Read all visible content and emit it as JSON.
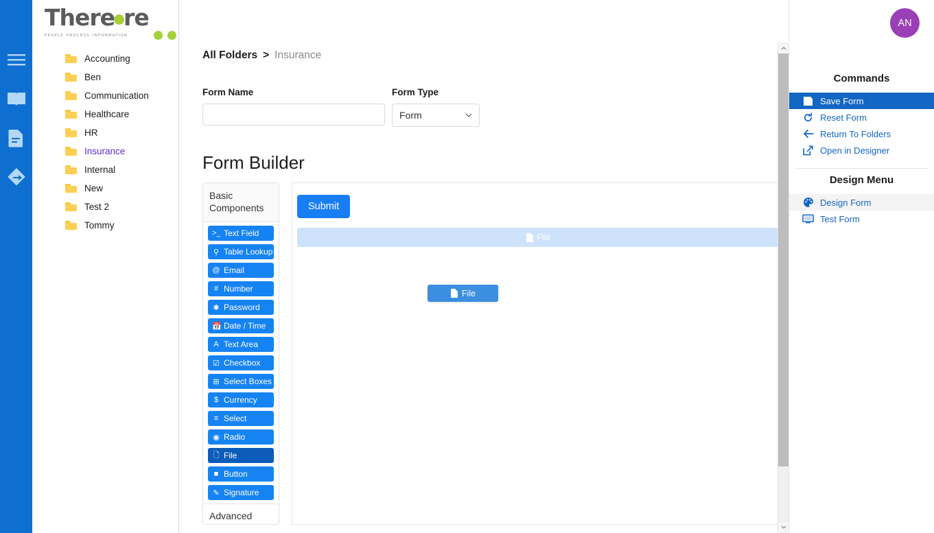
{
  "rail": {
    "icons": [
      {
        "name": "hamburger-menu-icon",
        "label": "Menu"
      },
      {
        "name": "book-icon",
        "label": "Library"
      },
      {
        "name": "document-icon",
        "label": "Documents"
      },
      {
        "name": "workflow-icon",
        "label": "Workflow"
      }
    ]
  },
  "brand": {
    "name_part1": "There",
    "name_part2": "re",
    "tagline_words": [
      "PEOPLE",
      "PROCESS",
      "INFORMATION"
    ],
    "accent_color": "#a7cf38",
    "text_color": "#5b5b5b"
  },
  "tree": {
    "items": [
      {
        "label": "Accounting",
        "expandable": false,
        "selected": false
      },
      {
        "label": "Ben",
        "expandable": false,
        "selected": false
      },
      {
        "label": "Communication",
        "expandable": true,
        "selected": false
      },
      {
        "label": "Healthcare",
        "expandable": false,
        "selected": false
      },
      {
        "label": "HR",
        "expandable": true,
        "selected": false
      },
      {
        "label": "Insurance",
        "expandable": false,
        "selected": true
      },
      {
        "label": "Internal",
        "expandable": true,
        "selected": false
      },
      {
        "label": "New",
        "expandable": false,
        "selected": false
      },
      {
        "label": "Test 2",
        "expandable": false,
        "selected": false
      },
      {
        "label": "Tommy",
        "expandable": false,
        "selected": false
      }
    ],
    "selected_color": "#5b2ecc"
  },
  "header": {
    "avatar_initials": "AN",
    "avatar_color": "#9a3fb5"
  },
  "breadcrumb": {
    "root": "All Folders",
    "separator": ">",
    "current": "Insurance"
  },
  "form_meta": {
    "form_name_label": "Form Name",
    "form_name_value": "",
    "form_name_placeholder": "",
    "form_type_label": "Form Type",
    "form_type_value": "Form",
    "form_type_options": [
      "Form"
    ]
  },
  "builder": {
    "title": "Form Builder",
    "palette": {
      "heading": "Basic Components",
      "components": [
        {
          "label": "Text Field",
          "icon": "terminal-icon",
          "glyph": ">_",
          "active": false
        },
        {
          "label": "Table Lookup",
          "icon": "lookup-icon",
          "glyph": "⚲",
          "active": false
        },
        {
          "label": "Email",
          "icon": "at-icon",
          "glyph": "@",
          "active": false
        },
        {
          "label": "Number",
          "icon": "hash-icon",
          "glyph": "#",
          "active": false
        },
        {
          "label": "Password",
          "icon": "asterisk-icon",
          "glyph": "✱",
          "active": false
        },
        {
          "label": "Date / Time",
          "icon": "calendar-icon",
          "glyph": "Ὄ5",
          "active": false
        },
        {
          "label": "Text Area",
          "icon": "text-size-icon",
          "glyph": "A",
          "active": false
        },
        {
          "label": "Checkbox",
          "icon": "checkbox-icon",
          "glyph": "☑",
          "active": false
        },
        {
          "label": "Select Boxes",
          "icon": "plus-square-icon",
          "glyph": "⊞",
          "active": false
        },
        {
          "label": "Currency",
          "icon": "dollar-icon",
          "glyph": "$",
          "active": false
        },
        {
          "label": "Select",
          "icon": "list-icon",
          "glyph": "☰",
          "active": false
        },
        {
          "label": "Radio",
          "icon": "radio-icon",
          "glyph": "◉",
          "active": false
        },
        {
          "label": "File",
          "icon": "file-icon",
          "glyph": "Ὄ4",
          "active": true
        },
        {
          "label": "Button",
          "icon": "square-icon",
          "glyph": "■",
          "active": false
        },
        {
          "label": "Signature",
          "icon": "pencil-icon",
          "glyph": "✎",
          "active": false
        }
      ],
      "next_section": "Advanced"
    },
    "canvas": {
      "submit_label": "Submit",
      "drop_placeholder_label": "File",
      "drag_ghost_label": "File"
    }
  },
  "commands": {
    "title": "Commands",
    "items": [
      {
        "label": "Save Form",
        "icon": "save-icon",
        "state": "selected"
      },
      {
        "label": "Reset Form",
        "icon": "refresh-icon",
        "state": "normal"
      },
      {
        "label": "Return To Folders",
        "icon": "arrow-left-icon",
        "state": "normal"
      },
      {
        "label": "Open in Designer",
        "icon": "external-link-icon",
        "state": "normal"
      }
    ]
  },
  "design_menu": {
    "title": "Design Menu",
    "items": [
      {
        "label": "Design Form",
        "icon": "palette-icon",
        "state": "hovered"
      },
      {
        "label": "Test Form",
        "icon": "monitor-icon",
        "state": "normal"
      }
    ]
  },
  "scrollbar": {
    "up_arrow": "▲",
    "down_arrow": "▼"
  }
}
